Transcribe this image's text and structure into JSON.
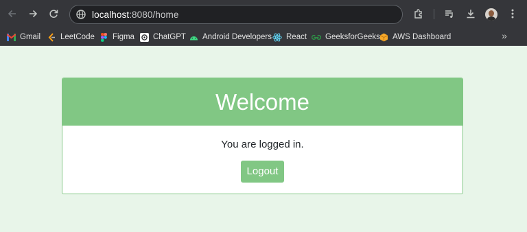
{
  "browser": {
    "url_host": "localhost",
    "url_rest": ":8080/home",
    "bookmarks": [
      {
        "label": "Gmail",
        "icon": "gmail-icon"
      },
      {
        "label": "LeetCode",
        "icon": "leetcode-icon"
      },
      {
        "label": "Figma",
        "icon": "figma-icon"
      },
      {
        "label": "ChatGPT",
        "icon": "chatgpt-icon"
      },
      {
        "label": "Android Developers",
        "icon": "android-icon"
      },
      {
        "label": "React",
        "icon": "react-icon"
      },
      {
        "label": "GeeksforGeeks",
        "icon": "geeksforgeeks-icon"
      },
      {
        "label": "AWS Dashboard",
        "icon": "aws-icon"
      }
    ],
    "more_icon": "»"
  },
  "card": {
    "title": "Welcome",
    "message": "You are logged in.",
    "logout_label": "Logout"
  },
  "colors": {
    "page_background": "#e8f5e9",
    "accent": "#81c784",
    "toolbar": "#35363a"
  }
}
